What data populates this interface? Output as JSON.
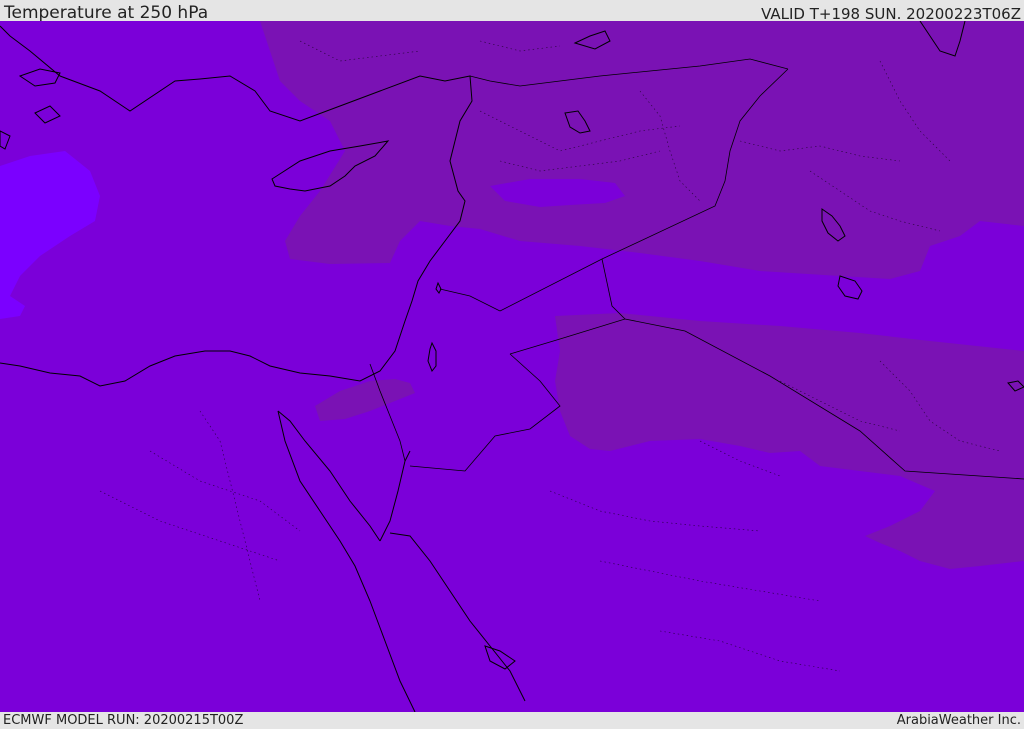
{
  "header": {
    "title": "Temperature at 250 hPa",
    "valid": "VALID T+198 SUN. 20200223T06Z"
  },
  "footer": {
    "model_run": "ECMWF MODEL RUN: 20200215T00Z",
    "credit": "ArabiaWeather Inc."
  },
  "map": {
    "field": "temperature",
    "level": "250 hPa",
    "colors": {
      "base_fill": "#7b00d9",
      "warmer_band": "#7a12b4",
      "colder_patch": "#7b00ff",
      "coastline": "#000000",
      "borders": "#000000"
    }
  }
}
